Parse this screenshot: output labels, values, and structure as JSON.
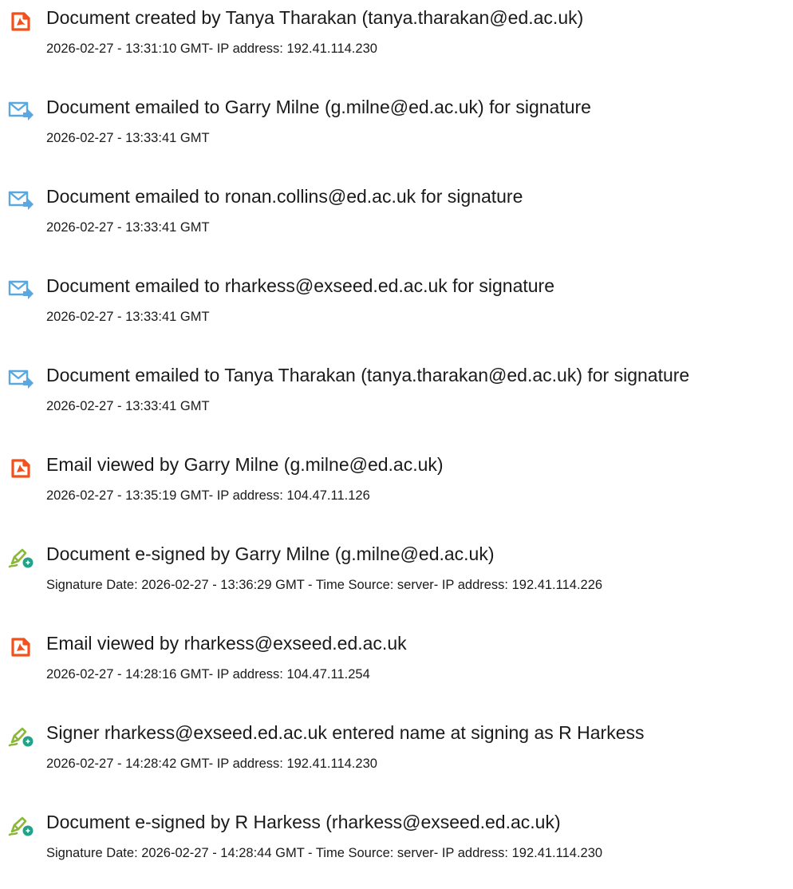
{
  "colors": {
    "text": "#1a1a1a",
    "pdf_icon": "#f2511b",
    "email_icon": "#5aa8e0",
    "sign_icon_pen": "#8cb83a",
    "sign_icon_badge": "#1fa38a"
  },
  "events": [
    {
      "icon": "pdf-document-icon",
      "title": "Document created by Tanya Tharakan (tanya.tharakan@ed.ac.uk)",
      "meta": "2026-02-27 - 13:31:10 GMT- IP address: 192.41.114.230"
    },
    {
      "icon": "email-sent-icon",
      "title": "Document emailed to Garry Milne (g.milne@ed.ac.uk) for signature",
      "meta": "2026-02-27 - 13:33:41 GMT"
    },
    {
      "icon": "email-sent-icon",
      "title": "Document emailed to ronan.collins@ed.ac.uk for signature",
      "meta": "2026-02-27 - 13:33:41 GMT"
    },
    {
      "icon": "email-sent-icon",
      "title": "Document emailed to rharkess@exseed.ed.ac.uk for signature",
      "meta": "2026-02-27 - 13:33:41 GMT"
    },
    {
      "icon": "email-sent-icon",
      "title": "Document emailed to Tanya Tharakan (tanya.tharakan@ed.ac.uk) for signature",
      "meta": "2026-02-27 - 13:33:41 GMT"
    },
    {
      "icon": "pdf-document-icon",
      "title": "Email viewed by Garry Milne (g.milne@ed.ac.uk)",
      "meta": "2026-02-27 - 13:35:19 GMT- IP address: 104.47.11.126"
    },
    {
      "icon": "e-sign-pen-icon",
      "title": "Document e-signed by Garry Milne (g.milne@ed.ac.uk)",
      "meta": "Signature Date: 2026-02-27 - 13:36:29 GMT - Time Source: server- IP address: 192.41.114.226"
    },
    {
      "icon": "pdf-document-icon",
      "title": "Email viewed by rharkess@exseed.ed.ac.uk",
      "meta": "2026-02-27 - 14:28:16 GMT- IP address: 104.47.11.254"
    },
    {
      "icon": "e-sign-pen-icon",
      "title": "Signer rharkess@exseed.ed.ac.uk entered name at signing as R Harkess",
      "meta": "2026-02-27 - 14:28:42 GMT- IP address: 192.41.114.230"
    },
    {
      "icon": "e-sign-pen-icon",
      "title": "Document e-signed by R Harkess (rharkess@exseed.ed.ac.uk)",
      "meta": "Signature Date: 2026-02-27 - 14:28:44 GMT - Time Source: server- IP address: 192.41.114.230"
    }
  ]
}
